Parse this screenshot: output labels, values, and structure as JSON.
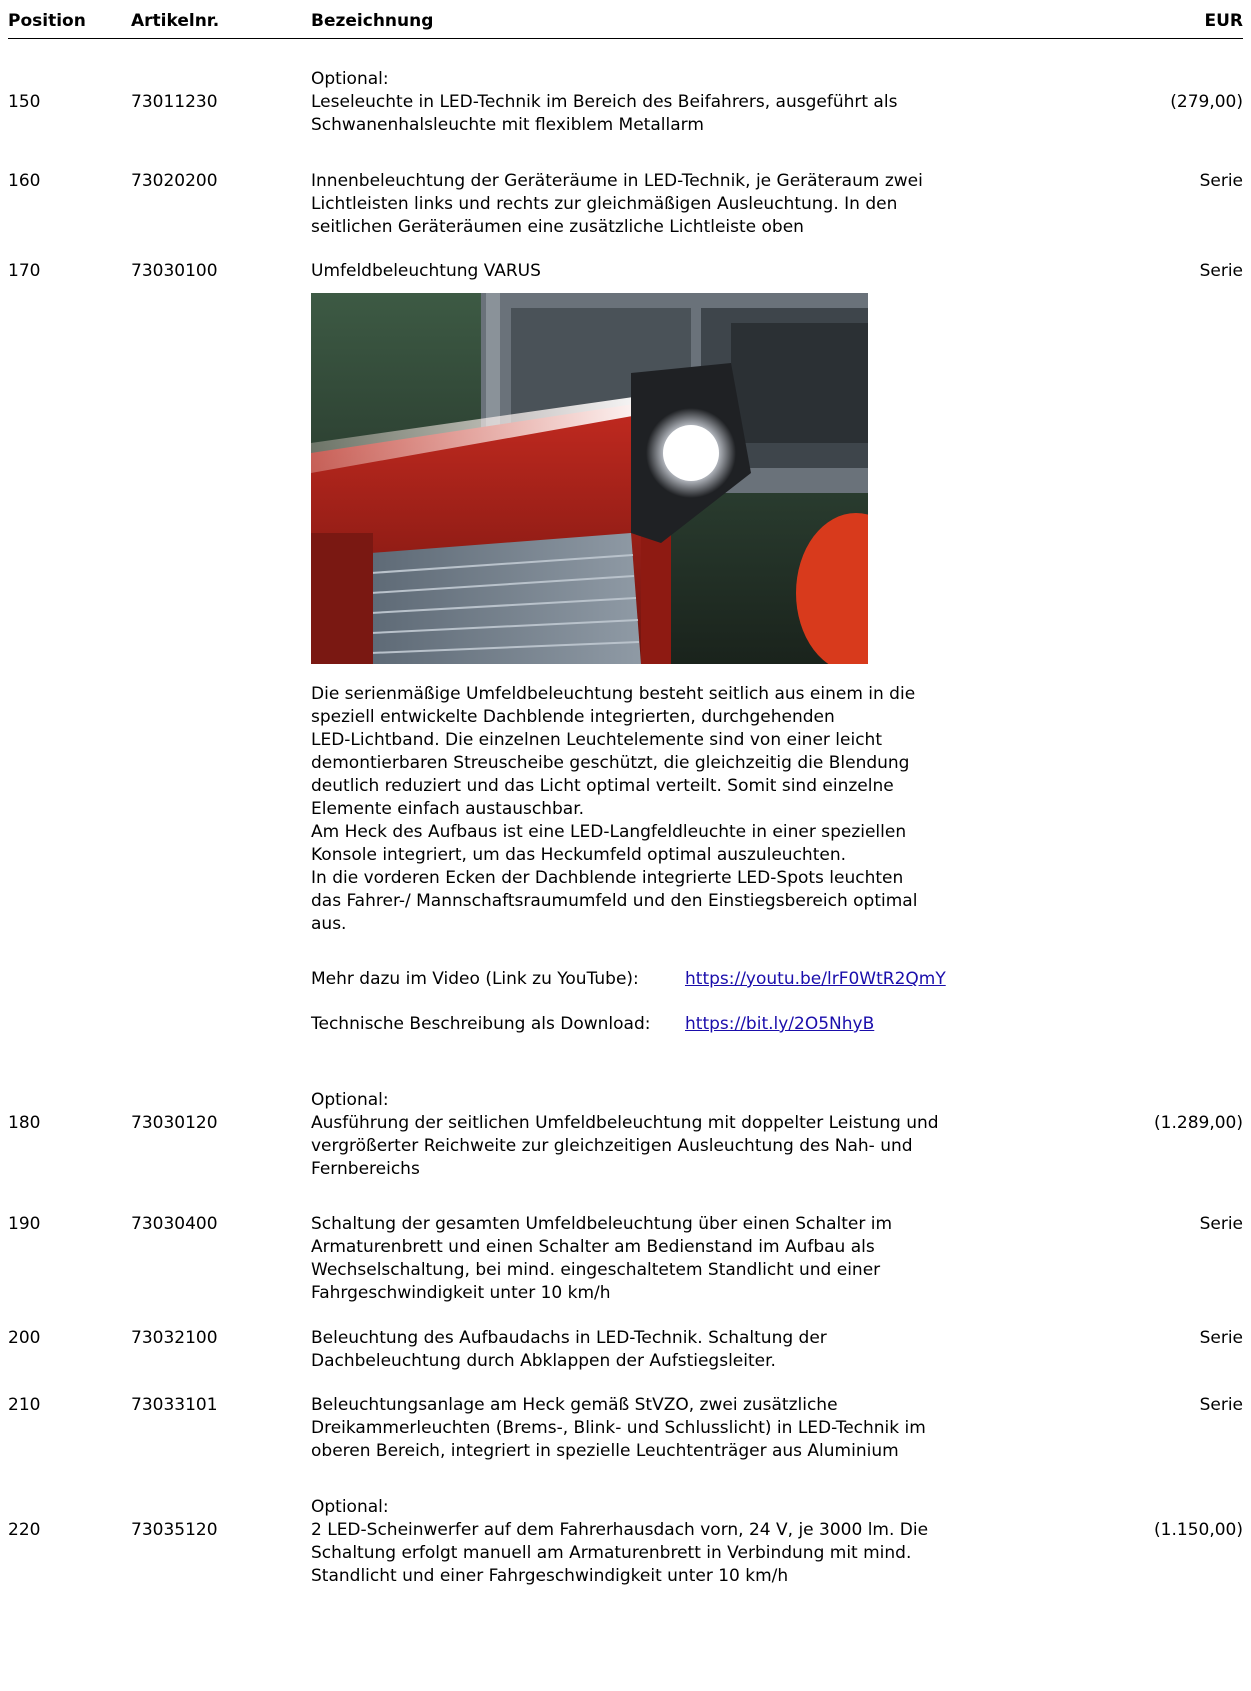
{
  "header": {
    "position": "Position",
    "article": "Artikelnr.",
    "description": "Bezeichnung",
    "currency": "EUR"
  },
  "items": [
    {
      "pos": "150",
      "art": "73011230",
      "optional": "Optional:",
      "lines": [
        "Leseleuchte in LED-Technik im Bereich des Beifahrers, ausgeführt als",
        "Schwanenhalsleuchte mit flexiblem Metallarm"
      ],
      "price": "(279,00)"
    },
    {
      "pos": "160",
      "art": "73020200",
      "lines": [
        "Innenbeleuchtung der Geräteräume in LED-Technik, je Geräteraum zwei",
        "Lichtleisten links und rechts zur gleichmäßigen Ausleuchtung. In den",
        "seitlichen Geräteräumen eine zusätzliche Lichtleiste oben"
      ],
      "price": "Serie"
    },
    {
      "pos": "170",
      "art": "73030100",
      "lines": [
        "Umfeldbeleuchtung VARUS"
      ],
      "price": "Serie",
      "body_lines": [
        "Die serienmäßige Umfeldbeleuchtung besteht seitlich aus einem in die",
        "speziell entwickelte Dachblende integrierten, durchgehenden",
        "LED-Lichtband. Die einzelnen Leuchtelemente sind von einer leicht",
        "demontierbaren Streuscheibe geschützt, die gleichzeitig die Blendung",
        "deutlich reduziert und das Licht optimal verteilt. Somit sind einzelne",
        "Elemente einfach austauschbar.",
        "Am Heck des Aufbaus ist eine LED-Langfeldleuchte in einer speziellen",
        "Konsole integriert, um das Heckumfeld optimal auszuleuchten.",
        "In die vorderen Ecken der Dachblende integrierte LED-Spots leuchten",
        "das Fahrer-/ Mannschaftsraumumfeld und den Einstiegsbereich optimal",
        "aus."
      ],
      "video_label": "Mehr dazu im Video (Link zu YouTube):",
      "video_url": "https://youtu.be/lrF0WtR2QmY",
      "download_label": "Technische Beschreibung als Download:",
      "download_url": "https://bit.ly/2O5NhyB"
    },
    {
      "pos": "180",
      "art": "73030120",
      "optional": "Optional:",
      "lines": [
        "Ausführung der seitlichen Umfeldbeleuchtung mit doppelter Leistung und",
        "vergrößerter Reichweite zur gleichzeitigen Ausleuchtung des Nah- und",
        "Fernbereichs"
      ],
      "price": "(1.289,00)"
    },
    {
      "pos": "190",
      "art": "73030400",
      "lines": [
        "Schaltung der gesamten Umfeldbeleuchtung über einen Schalter im",
        "Armaturenbrett und einen Schalter am Bedienstand im Aufbau als",
        "Wechselschaltung, bei mind. eingeschaltetem Standlicht und einer",
        "Fahrgeschwindigkeit unter 10 km/h"
      ],
      "price": "Serie"
    },
    {
      "pos": "200",
      "art": "73032100",
      "lines": [
        "Beleuchtung des Aufbaudachs in LED-Technik. Schaltung der",
        "Dachbeleuchtung durch Abklappen der Aufstiegsleiter."
      ],
      "price": "Serie"
    },
    {
      "pos": "210",
      "art": "73033101",
      "lines": [
        "Beleuchtungsanlage am Heck gemäß StVZO, zwei zusätzliche",
        "Dreikammerleuchten (Brems-, Blink- und Schlusslicht) in LED-Technik im",
        "oberen Bereich, integriert in spezielle Leuchtenträger aus Aluminium"
      ],
      "price": "Serie"
    },
    {
      "pos": "220",
      "art": "73035120",
      "optional": "Optional:",
      "lines": [
        "2 LED-Scheinwerfer auf dem Fahrerhausdach vorn, 24 V, je 3000 lm. Die",
        "Schaltung erfolgt manuell am Armaturenbrett in Verbindung mit mind.",
        "Standlicht und einer Fahrgeschwindigkeit unter 10 km/h"
      ],
      "price": "(1.150,00)"
    }
  ]
}
